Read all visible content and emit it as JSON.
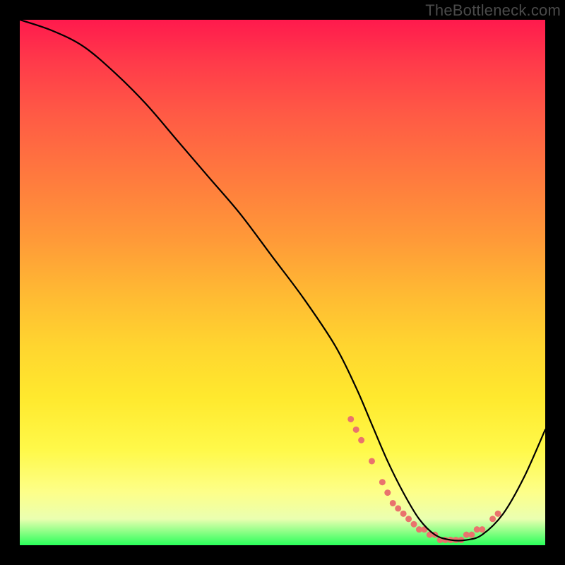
{
  "watermark": "TheBottleneck.com",
  "chart_data": {
    "type": "line",
    "title": "",
    "xlabel": "",
    "ylabel": "",
    "xlim": [
      0,
      100
    ],
    "ylim": [
      0,
      100
    ],
    "series": [
      {
        "name": "bottleneck-curve",
        "x": [
          0,
          6,
          12,
          18,
          24,
          30,
          36,
          42,
          48,
          54,
          60,
          64,
          67,
          70,
          73,
          76,
          79,
          82,
          85,
          88,
          92,
          96,
          100
        ],
        "values": [
          100,
          98,
          95,
          90,
          84,
          77,
          70,
          63,
          55,
          47,
          38,
          30,
          23,
          16,
          10,
          5,
          2,
          1,
          1,
          2,
          6,
          13,
          22
        ]
      }
    ],
    "marker_cluster": {
      "comment": "coral dots near trough",
      "x": [
        63,
        64,
        65,
        67,
        69,
        70,
        71,
        72,
        73,
        74,
        75,
        76,
        77,
        78,
        79,
        80,
        81,
        82,
        83,
        84,
        85,
        86,
        87,
        88,
        90,
        91
      ],
      "values": [
        24,
        22,
        20,
        16,
        12,
        10,
        8,
        7,
        6,
        5,
        4,
        3,
        3,
        2,
        2,
        1,
        1,
        1,
        1,
        1,
        2,
        2,
        3,
        3,
        5,
        6
      ]
    },
    "colors": {
      "curve": "#000000",
      "markers": "#e9736d",
      "gradient_top": "#ff1a4d",
      "gradient_bottom": "#2aff5a",
      "frame": "#000000"
    }
  }
}
